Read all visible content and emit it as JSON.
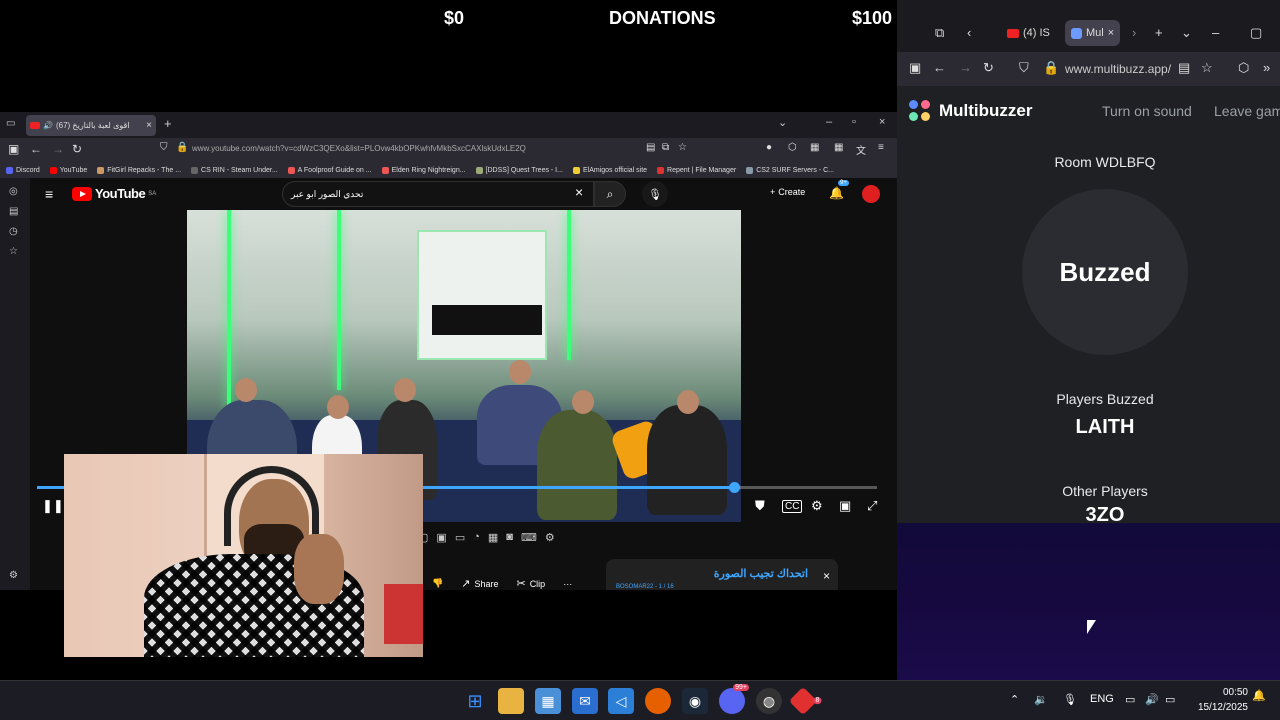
{
  "overlay": {
    "donation_left": "$0",
    "donation_title": "DONATIONS",
    "donation_right": "$100"
  },
  "left_browser": {
    "tab_title": "(67) اقوى لعبة بالتاريخ",
    "url": "www.youtube.com/watch?v=cdWzC3QEXo&list=PLOvw4kbOPKwhfvMkbSxcCAXlskUdxLE2Q",
    "bookmarks": [
      "Discord",
      "YouTube",
      "FitGirl Repacks - The ...",
      "CS RIN - Steam Under...",
      "A Foolproof Guide on ...",
      "Elden Ring Nightreign...",
      "[DDSS] Quest Trees - I...",
      "ElAmigos official site",
      "Repent | File Manager",
      "CS2 SURF Servers - C..."
    ]
  },
  "youtube": {
    "logo": "YouTube",
    "country": "SA",
    "search_value": "تحدي الصور ابو عبر",
    "create_label": "Create",
    "notif_badge": "9+",
    "progress": 0.83,
    "share_label": "Share",
    "clip_label": "Clip",
    "playlist_title": "اتحداك تجيب الصورة",
    "playlist_sub": "BOSOMAR22 - 1 / 16"
  },
  "right_browser": {
    "tab1": "(4) IS",
    "tab2": "Mul",
    "url": "www.multibuzz.app/",
    "brand": "Multibuzzer",
    "turn_on_sound": "Turn on sound",
    "leave_game": "Leave game",
    "room": "Room WDLBFQ",
    "buzz_state": "Buzzed",
    "players_buzzed_label": "Players Buzzed",
    "players_buzzed_value": "LAITH",
    "other_players_label": "Other Players",
    "other_players_value": "3ZO"
  },
  "taskbar": {
    "lang": "ENG",
    "time": "00:50",
    "date": "15/12/2025",
    "discord_badge": "99+",
    "app_badge": "8"
  },
  "colors": {
    "youtube_red": "#ff0000",
    "progress_blue": "#3ea6ff",
    "multibuzzer_bg": "#1f2023"
  }
}
